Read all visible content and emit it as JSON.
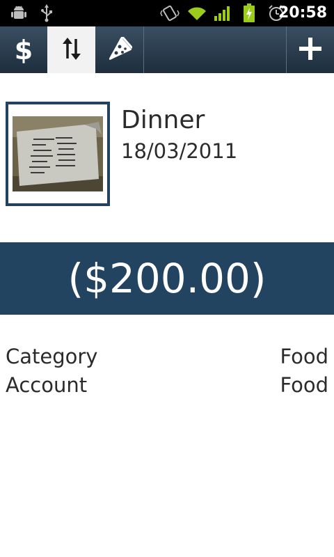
{
  "status_bar": {
    "time": "20:58",
    "icons": [
      "android-debug-icon",
      "usb-icon",
      "vibrate-icon",
      "wifi-icon",
      "signal-icon",
      "battery-charging-icon",
      "alarm-icon"
    ]
  },
  "action_bar": {
    "buttons": [
      {
        "name": "transactions-tab",
        "icon": "dollar-icon",
        "label": "$",
        "selected": false
      },
      {
        "name": "sort-tab",
        "icon": "sort-arrows-icon",
        "selected": true
      },
      {
        "name": "category-tab",
        "icon": "pizza-icon",
        "selected": false
      },
      {
        "name": "add-button",
        "icon": "plus-icon",
        "label": "+"
      }
    ],
    "colors": {
      "bar_top": "#3a4f62",
      "bar_bottom": "#1d2d3c",
      "selected_bg": "#f2f2f2"
    }
  },
  "transaction": {
    "title": "Dinner",
    "date": "18/03/2011",
    "amount": "($200.00)",
    "thumbnail": "receipt-photo"
  },
  "details": [
    {
      "label": "Category",
      "value": "Food"
    },
    {
      "label": "Account",
      "value": "Food"
    }
  ],
  "colors": {
    "accent": "#234461",
    "text": "#2b2b2b"
  }
}
